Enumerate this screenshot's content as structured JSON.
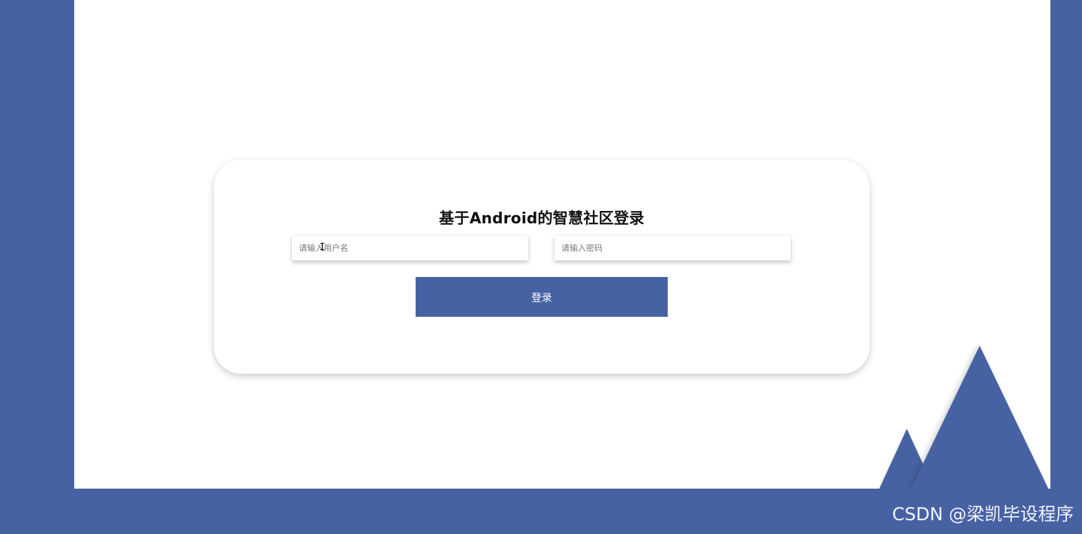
{
  "colors": {
    "brand": "#4762a3",
    "background": "#ffffff",
    "title": "#111111",
    "placeholder": "#7a7a7a",
    "button_text": "#ffffff"
  },
  "login": {
    "title": "基于Android的智慧社区登录",
    "username": {
      "value": "",
      "placeholder": "请输入用户名"
    },
    "password": {
      "value": "",
      "placeholder": "请输入密码"
    },
    "submit_label": "登录"
  },
  "cursor": {
    "icon": "text-cursor-icon"
  },
  "decorations": {
    "shapes": [
      "triangle",
      "triangle"
    ]
  },
  "watermark": "CSDN @梁凯毕设程序"
}
